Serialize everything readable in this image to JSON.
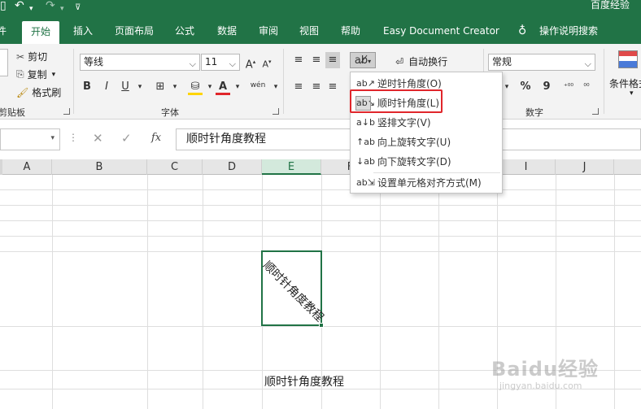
{
  "titlebar": {
    "app_title": "百度经验"
  },
  "tabs": [
    {
      "label": "件"
    },
    {
      "label": "开始"
    },
    {
      "label": "插入"
    },
    {
      "label": "页面布局"
    },
    {
      "label": "公式"
    },
    {
      "label": "数据"
    },
    {
      "label": "审阅"
    },
    {
      "label": "视图"
    },
    {
      "label": "帮助"
    },
    {
      "label": "Easy Document Creator"
    },
    {
      "label": "操作说明搜索"
    }
  ],
  "clipboard": {
    "cut": "剪切",
    "copy": "复制",
    "format_painter": "格式刷",
    "group": "剪贴板"
  },
  "font": {
    "name": "等线",
    "size": "11",
    "grow": "A",
    "shrink": "A",
    "bold": "B",
    "italic": "I",
    "underline": "U",
    "phonetic": "wén",
    "group": "字体"
  },
  "alignment": {
    "wrap_text": "自动换行"
  },
  "number": {
    "format": "常规",
    "percent": "%",
    "comma": "9",
    "group": "数字"
  },
  "styles": {
    "conditional": "条件格式"
  },
  "formula": {
    "fx": "fx",
    "content": "顺时针角度教程"
  },
  "columns": [
    "A",
    "B",
    "C",
    "D",
    "E",
    "F",
    "G",
    "H",
    "I",
    "J"
  ],
  "orientation_menu": {
    "items": [
      {
        "label": "逆时针角度(O)"
      },
      {
        "label": "顺时针角度(L)"
      },
      {
        "label": "竖排文字(V)"
      },
      {
        "label": "向上旋转文字(U)"
      },
      {
        "label": "向下旋转文字(D)"
      },
      {
        "label": "设置单元格对齐方式(M)"
      }
    ]
  },
  "cells": {
    "rotated_text": "顺时针角度教程",
    "bottom_text": "顺时针角度教程"
  },
  "watermark": {
    "logo": "Baidu经验",
    "url": "jingyan.baidu.com"
  },
  "colors": {
    "accent": "#217346",
    "highlight_box": "#e0262b"
  }
}
